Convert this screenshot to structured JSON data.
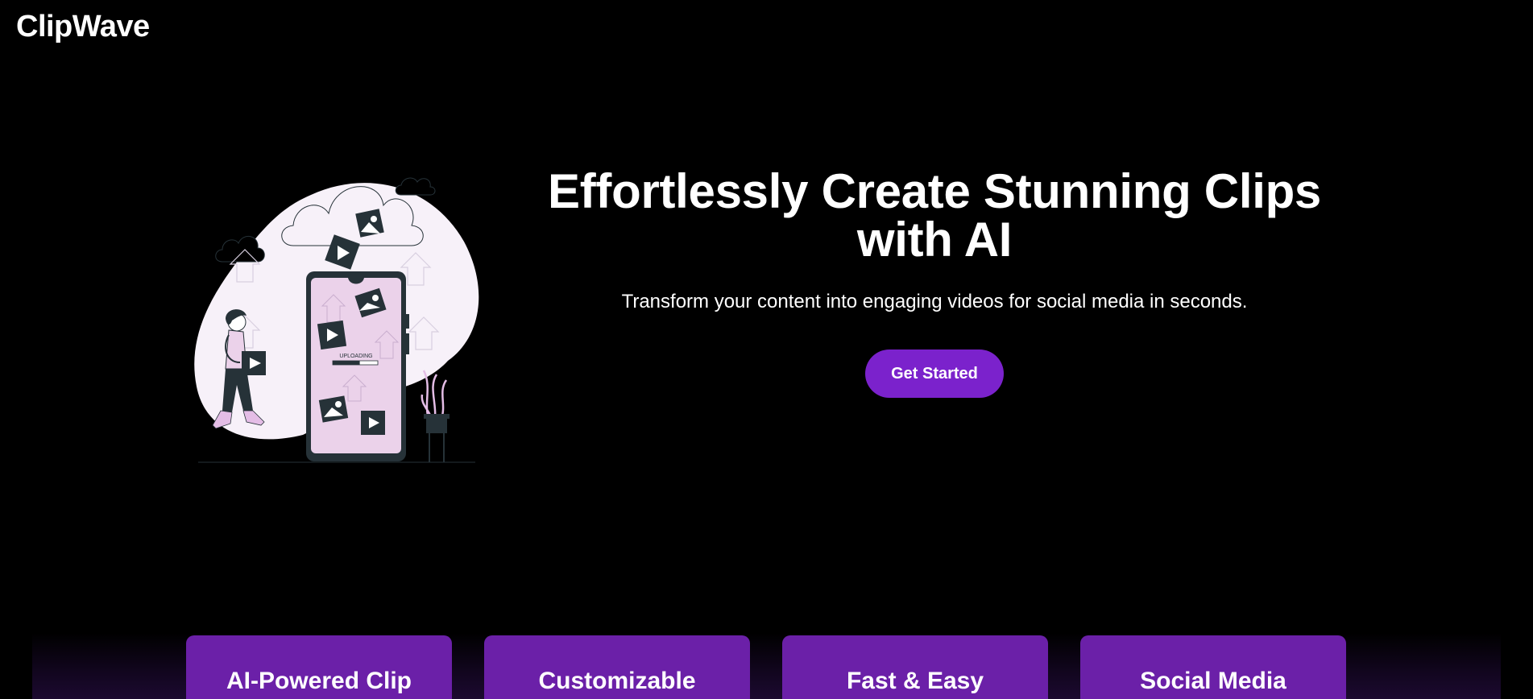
{
  "header": {
    "logo_text": "ClipWave"
  },
  "hero": {
    "title": "Effortlessly Create Stunning Clips with AI",
    "subtitle": "Transform your content into engaging videos for social media in seconds.",
    "cta_label": "Get Started",
    "illustration": {
      "phone_label": "UPLOADING",
      "upload_progress": 0.6
    }
  },
  "features": [
    {
      "title": "AI-Powered Clip"
    },
    {
      "title": "Customizable"
    },
    {
      "title": "Fast & Easy"
    },
    {
      "title": "Social Media"
    }
  ],
  "colors": {
    "background": "#000000",
    "accent": "#7b22cc",
    "card": "#6b20a8",
    "blob": "#f7f1f9",
    "phone_screen": "#ebd2ea",
    "dark": "#263238"
  }
}
